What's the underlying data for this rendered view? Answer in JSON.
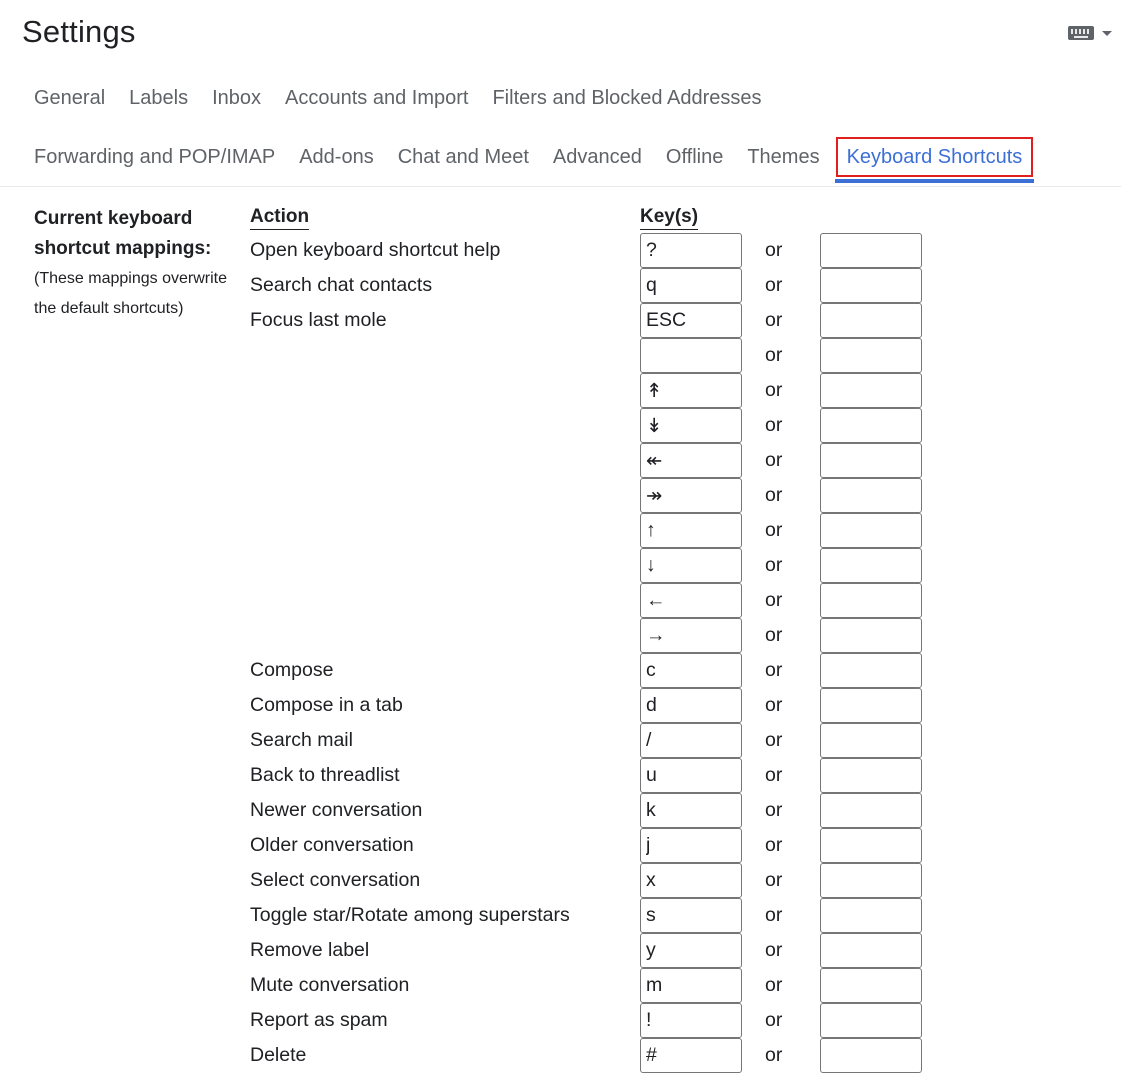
{
  "header": {
    "title": "Settings",
    "input_tools_icon": "keyboard-icon",
    "input_tools_dropdown_icon": "caret-down-icon"
  },
  "tabs_row1": [
    {
      "label": "General"
    },
    {
      "label": "Labels"
    },
    {
      "label": "Inbox"
    },
    {
      "label": "Accounts and Import"
    },
    {
      "label": "Filters and Blocked Addresses"
    }
  ],
  "tabs_row2": [
    {
      "label": "Forwarding and POP/IMAP"
    },
    {
      "label": "Add-ons"
    },
    {
      "label": "Chat and Meet"
    },
    {
      "label": "Advanced"
    },
    {
      "label": "Offline"
    },
    {
      "label": "Themes"
    },
    {
      "label": "Keyboard Shortcuts",
      "active": true
    }
  ],
  "colors": {
    "active_tab": "#3c6fd6",
    "highlight_box": "#e0201e",
    "inactive_tab": "#5f6368"
  },
  "section": {
    "title": "Current keyboard shortcut mappings:",
    "note": "(These mappings overwrite the default shortcuts)",
    "action_header": "Action",
    "keys_header": "Key(s)",
    "or_label": "or"
  },
  "shortcuts": [
    {
      "action": "Open keyboard shortcut help",
      "key1": "?",
      "key2": ""
    },
    {
      "action": "Search chat contacts",
      "key1": "q",
      "key2": ""
    },
    {
      "action": "Focus last mole",
      "key1": "ESC",
      "key2": ""
    },
    {
      "action": "",
      "key1": "",
      "key2": ""
    },
    {
      "action": "",
      "key1": "↟",
      "key2": ""
    },
    {
      "action": "",
      "key1": "↡",
      "key2": ""
    },
    {
      "action": "",
      "key1": "↞",
      "key2": ""
    },
    {
      "action": "",
      "key1": "↠",
      "key2": ""
    },
    {
      "action": "",
      "key1": "↑",
      "key2": ""
    },
    {
      "action": "",
      "key1": "↓",
      "key2": ""
    },
    {
      "action": "",
      "key1": "←",
      "key2": ""
    },
    {
      "action": "",
      "key1": "→",
      "key2": ""
    },
    {
      "action": "Compose",
      "key1": "c",
      "key2": ""
    },
    {
      "action": "Compose in a tab",
      "key1": "d",
      "key2": ""
    },
    {
      "action": "Search mail",
      "key1": "/",
      "key2": ""
    },
    {
      "action": "Back to threadlist",
      "key1": "u",
      "key2": ""
    },
    {
      "action": "Newer conversation",
      "key1": "k",
      "key2": ""
    },
    {
      "action": "Older conversation",
      "key1": "j",
      "key2": ""
    },
    {
      "action": "Select conversation",
      "key1": "x",
      "key2": ""
    },
    {
      "action": "Toggle star/Rotate among superstars",
      "key1": "s",
      "key2": ""
    },
    {
      "action": "Remove label",
      "key1": "y",
      "key2": ""
    },
    {
      "action": "Mute conversation",
      "key1": "m",
      "key2": ""
    },
    {
      "action": "Report as spam",
      "key1": "!",
      "key2": ""
    },
    {
      "action": "Delete",
      "key1": "#",
      "key2": ""
    }
  ]
}
